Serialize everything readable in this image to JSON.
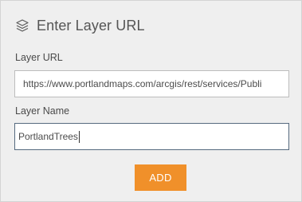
{
  "dialog": {
    "title": "Enter Layer URL",
    "header_icon": "layers-icon"
  },
  "layer_url": {
    "label": "Layer URL",
    "value": "https://www.portlandmaps.com/arcgis/rest/services/Publi"
  },
  "layer_name": {
    "label": "Layer Name",
    "value": "PortlandTrees"
  },
  "actions": {
    "add_label": "ADD"
  },
  "colors": {
    "panel_background": "#efefef",
    "button_accent": "#f0902a",
    "focused_border": "#566a7f"
  }
}
